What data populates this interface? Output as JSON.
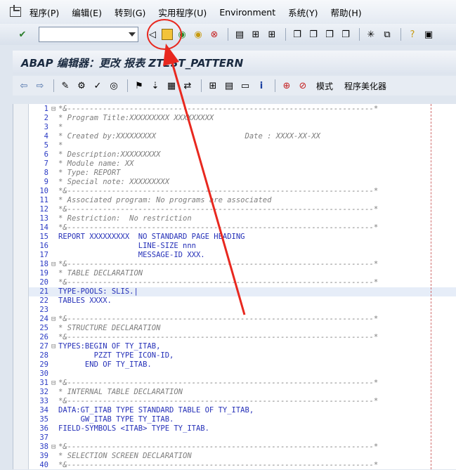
{
  "menu": [
    "程序(P)",
    "编辑(E)",
    "转到(G)",
    "实用程序(U)",
    "Environment",
    "系统(Y)",
    "帮助(H)"
  ],
  "title": "ABAP 编辑器：更改 报表 ZTEST_PATTERN",
  "toolbar2_labels": {
    "mode": "模式",
    "pretty": "程序美化器"
  },
  "lines": [
    {
      "n": "1",
      "fold": "⊟",
      "t": "*&---------------------------------------------------------------------*",
      "c": "cmt"
    },
    {
      "n": "2",
      "fold": "",
      "t": "* Program Title:XXXXXXXXX XXXXXXXXX",
      "c": "cmt"
    },
    {
      "n": "3",
      "fold": "",
      "t": "*",
      "c": "cmt"
    },
    {
      "n": "4",
      "fold": "",
      "t": "* Created by:XXXXXXXXX                    Date : XXXX-XX-XX",
      "c": "cmt"
    },
    {
      "n": "5",
      "fold": "",
      "t": "*",
      "c": "cmt"
    },
    {
      "n": "6",
      "fold": "",
      "t": "* Description:XXXXXXXXX",
      "c": "cmt"
    },
    {
      "n": "7",
      "fold": "",
      "t": "* Module name: XX",
      "c": "cmt"
    },
    {
      "n": "8",
      "fold": "",
      "t": "* Type: REPORT",
      "c": "cmt"
    },
    {
      "n": "9",
      "fold": "",
      "t": "* Special note: XXXXXXXXX",
      "c": "cmt"
    },
    {
      "n": "10",
      "fold": "",
      "t": "*&---------------------------------------------------------------------*",
      "c": "cmt"
    },
    {
      "n": "11",
      "fold": "",
      "t": "* Associated program: No programs are associated",
      "c": "cmt"
    },
    {
      "n": "12",
      "fold": "",
      "t": "*&---------------------------------------------------------------------*",
      "c": "cmt"
    },
    {
      "n": "13",
      "fold": "",
      "t": "* Restriction:  No restriction",
      "c": "cmt"
    },
    {
      "n": "14",
      "fold": "",
      "t": "*&---------------------------------------------------------------------*",
      "c": "cmt"
    },
    {
      "n": "15",
      "fold": "",
      "t": "REPORT XXXXXXXXX  NO STANDARD PAGE HEADING",
      "c": "code"
    },
    {
      "n": "16",
      "fold": "",
      "t": "                  LINE-SIZE nnn",
      "c": "code"
    },
    {
      "n": "17",
      "fold": "",
      "t": "                  MESSAGE-ID XXX.",
      "c": "code"
    },
    {
      "n": "18",
      "fold": "⊟",
      "t": "*&---------------------------------------------------------------------*",
      "c": "cmt"
    },
    {
      "n": "19",
      "fold": "",
      "t": "* TABLE DECLARATION",
      "c": "cmt"
    },
    {
      "n": "20",
      "fold": "",
      "t": "*&---------------------------------------------------------------------*",
      "c": "cmt"
    },
    {
      "n": "21",
      "fold": "",
      "t": "TYPE-POOLS: SLIS.|",
      "c": "code",
      "hl": true
    },
    {
      "n": "22",
      "fold": "",
      "t": "TABLES XXXX.",
      "c": "code"
    },
    {
      "n": "23",
      "fold": "",
      "t": "",
      "c": "code"
    },
    {
      "n": "24",
      "fold": "⊟",
      "t": "*&---------------------------------------------------------------------*",
      "c": "cmt"
    },
    {
      "n": "25",
      "fold": "",
      "t": "* STRUCTURE DECLARATION",
      "c": "cmt"
    },
    {
      "n": "26",
      "fold": "",
      "t": "*&---------------------------------------------------------------------*",
      "c": "cmt"
    },
    {
      "n": "27",
      "fold": "⊟",
      "t": "TYPES:BEGIN OF TY_ITAB,",
      "c": "code"
    },
    {
      "n": "28",
      "fold": "",
      "t": "        PZZT TYPE ICON-ID,",
      "c": "code"
    },
    {
      "n": "29",
      "fold": "",
      "t": "      END OF TY_ITAB.",
      "c": "code"
    },
    {
      "n": "30",
      "fold": "",
      "t": "",
      "c": "code"
    },
    {
      "n": "31",
      "fold": "⊟",
      "t": "*&---------------------------------------------------------------------*",
      "c": "cmt"
    },
    {
      "n": "32",
      "fold": "",
      "t": "* INTERNAL TABLE DECLARATION",
      "c": "cmt"
    },
    {
      "n": "33",
      "fold": "",
      "t": "*&---------------------------------------------------------------------*",
      "c": "cmt"
    },
    {
      "n": "34",
      "fold": "",
      "t": "DATA:GT_ITAB TYPE STANDARD TABLE OF TY_ITAB,",
      "c": "code"
    },
    {
      "n": "35",
      "fold": "",
      "t": "     GW_ITAB TYPE TY_ITAB.",
      "c": "code"
    },
    {
      "n": "36",
      "fold": "",
      "t": "FIELD-SYMBOLS <ITAB> TYPE TY_ITAB.",
      "c": "code"
    },
    {
      "n": "37",
      "fold": "",
      "t": "",
      "c": "code"
    },
    {
      "n": "38",
      "fold": "⊟",
      "t": "*&---------------------------------------------------------------------*",
      "c": "cmt"
    },
    {
      "n": "39",
      "fold": "",
      "t": "* SELECTION SCREEN DECLARATION",
      "c": "cmt"
    },
    {
      "n": "40",
      "fold": "",
      "t": "*&---------------------------------------------------------------------*",
      "c": "cmt"
    }
  ]
}
